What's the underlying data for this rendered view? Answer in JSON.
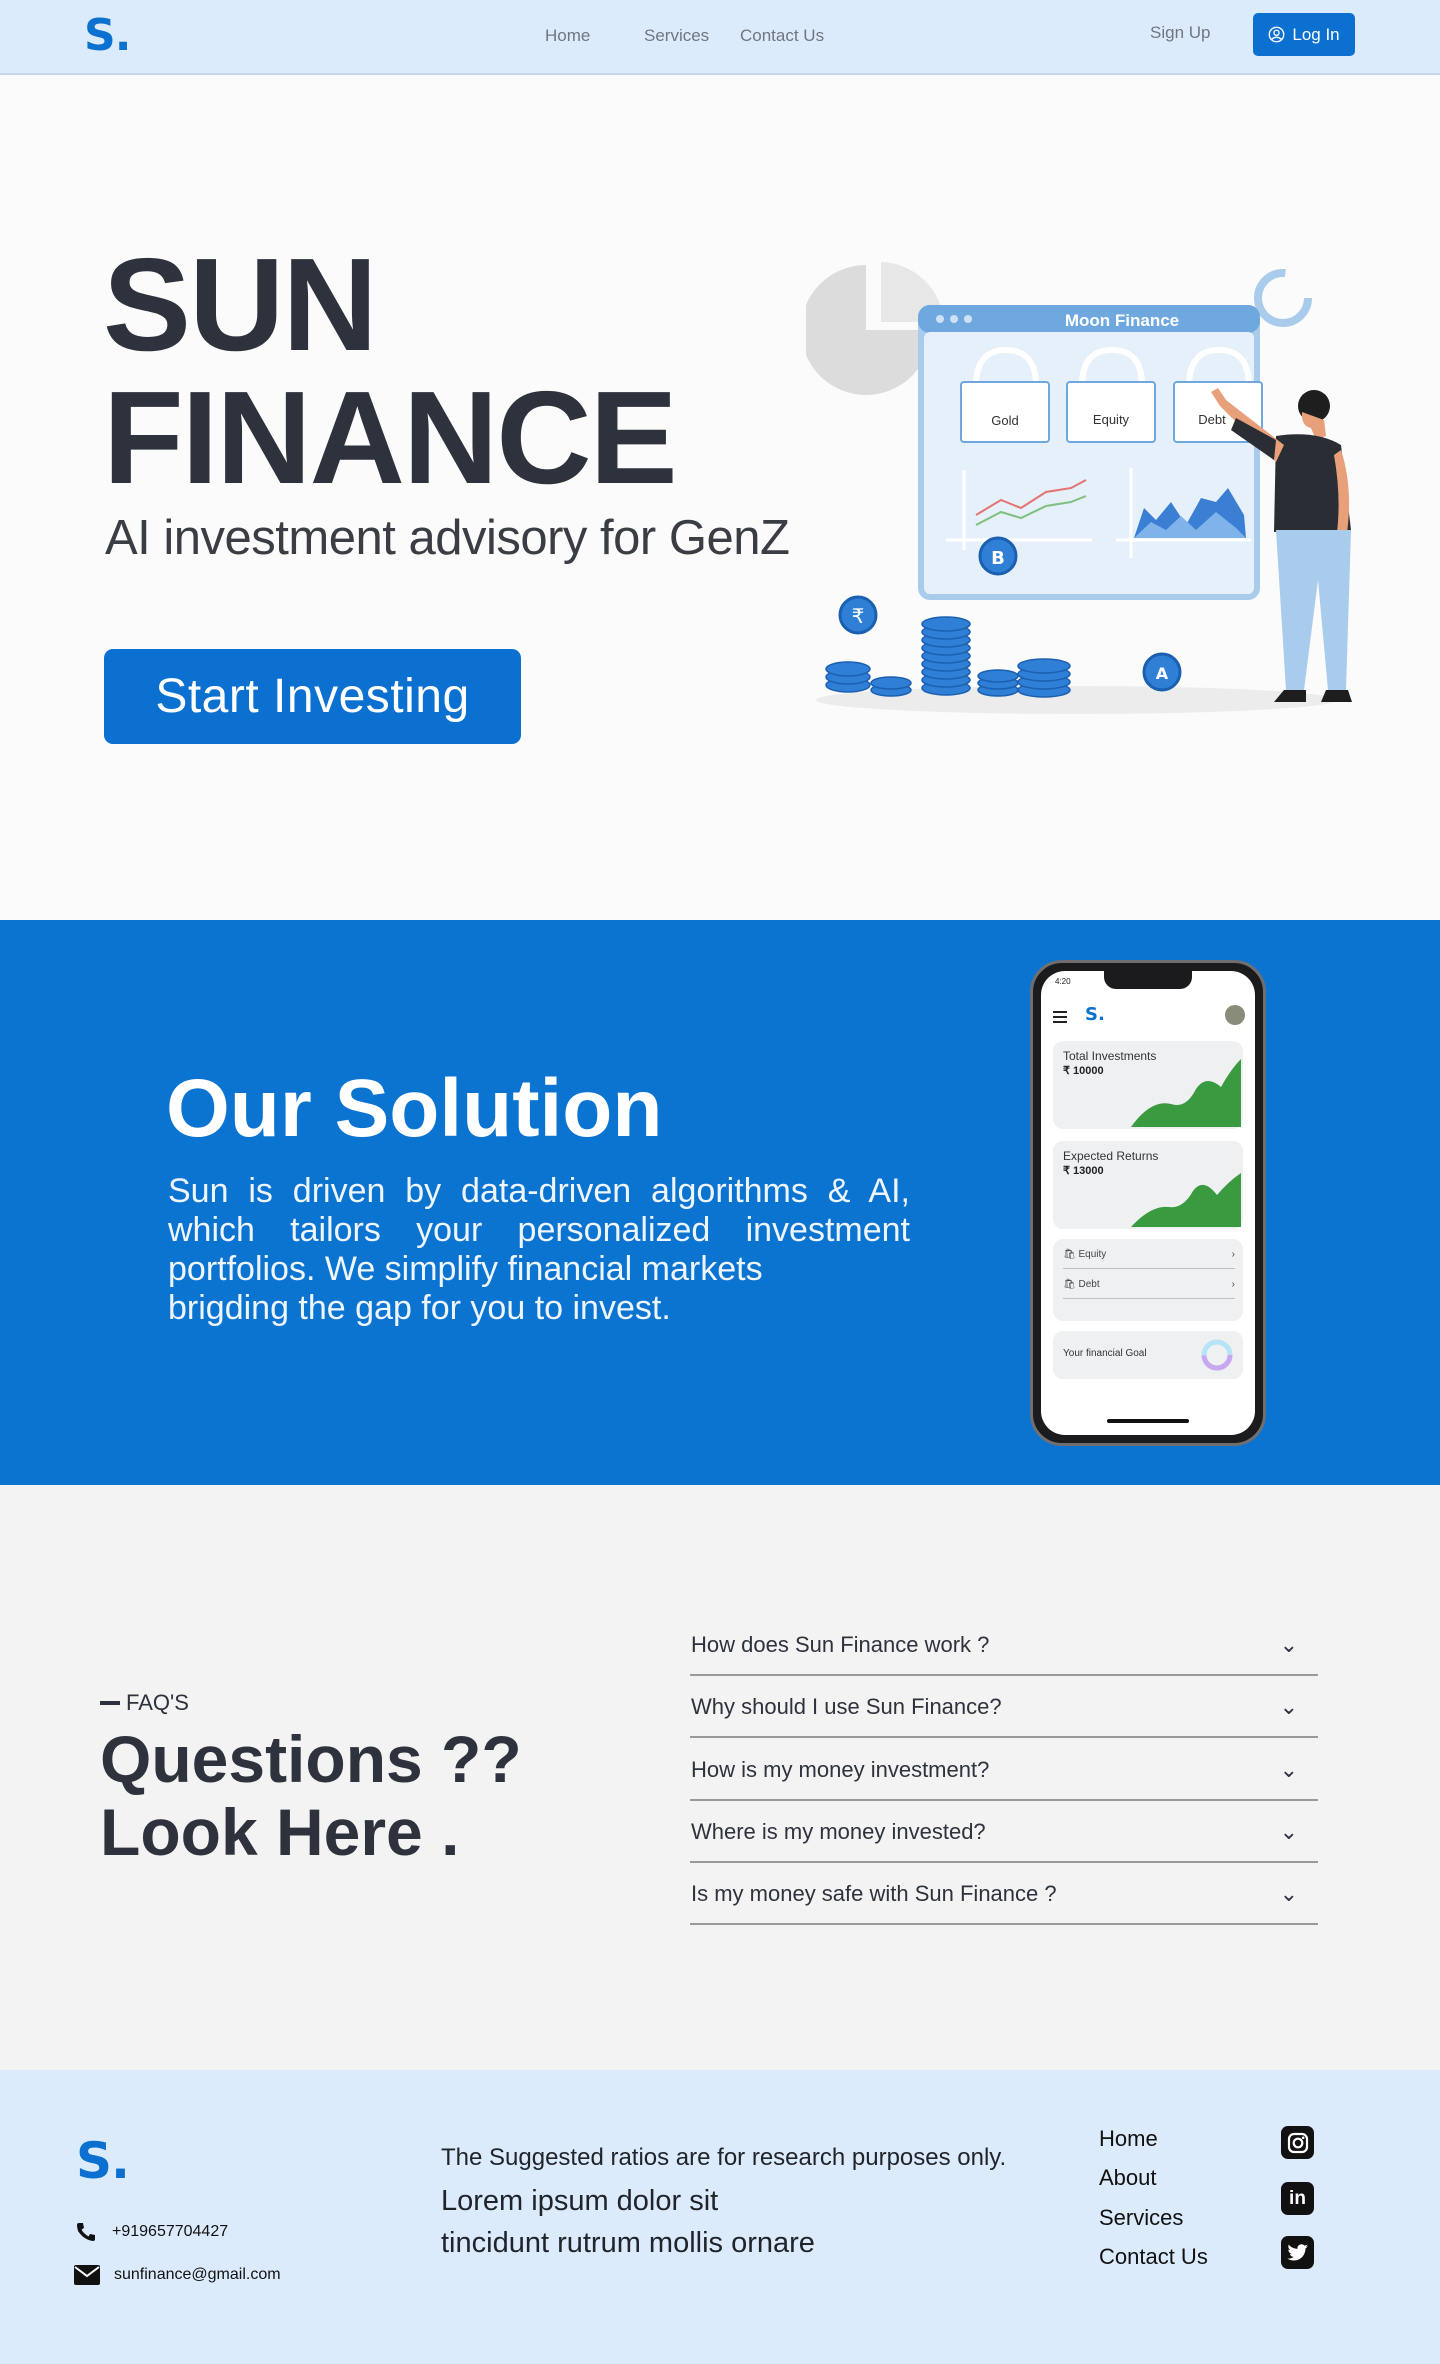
{
  "nav": {
    "logo": "S.",
    "links": [
      "Home",
      "Services",
      "Contact Us"
    ],
    "signup": "Sign Up",
    "login": "Log In"
  },
  "hero": {
    "title_line1": "SUN",
    "title_line2": "FINANCE",
    "subtitle": "AI investment advisory for GenZ",
    "cta": "Start Investing",
    "illustration": {
      "window_title": "Moon Finance",
      "bags": [
        "Gold",
        "Equity",
        "Debt"
      ]
    }
  },
  "solution": {
    "title": "Our Solution",
    "lines": [
      "Sun is driven by data-driven algorithms & AI,",
      "which tailors your personalized investment",
      "portfolios. We simplify financial markets",
      "brigding the gap for you to invest."
    ],
    "phone": {
      "time": "4:20",
      "logo": "S.",
      "total_label": "Total Investments",
      "total_value": "₹ 10000",
      "expected_label": "Expected Returns",
      "expected_value": "₹ 13000",
      "rows": [
        "Equity",
        "Debt"
      ],
      "goal_label": "Your financial Goal"
    }
  },
  "faq": {
    "tag": "FAQ'S",
    "heading_line1": "Questions ??",
    "heading_line2": "Look Here .",
    "items": [
      "How does Sun Finance work ?",
      "Why should I use Sun Finance?",
      "How is my money investment?",
      "Where is my money invested?",
      "Is my money safe with Sun Finance ?"
    ]
  },
  "footer": {
    "logo": "S.",
    "phone": "+919657704427",
    "email": "sunfinance@gmail.com",
    "note": "The Suggested ratios are for research purposes only.",
    "lorem_line1": "Lorem ipsum dolor sit",
    "lorem_line2": "tincidunt rutrum mollis ornare",
    "links": [
      "Home",
      "About",
      "Services",
      "Contact Us"
    ],
    "socials": [
      "instagram-icon",
      "linkedin-icon",
      "twitter-icon"
    ]
  },
  "colors": {
    "brand": "#0b70cf",
    "nav_bg": "#dcebfb",
    "solution_bg": "#0b74d0",
    "faq_bg": "#f3f3f3",
    "chart_green": "#3a9a3f"
  }
}
